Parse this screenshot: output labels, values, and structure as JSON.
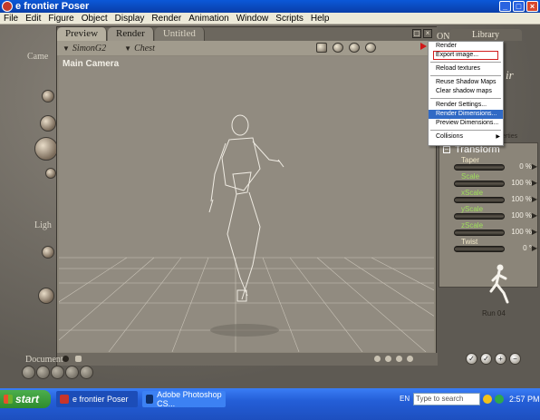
{
  "window": {
    "title": "e frontier Poser"
  },
  "menubar": [
    "File",
    "Edit",
    "Figure",
    "Object",
    "Display",
    "Render",
    "Animation",
    "Window",
    "Scripts",
    "Help"
  ],
  "left_palette": {
    "camera_label": "Came",
    "light_label": "Ligh",
    "document_label": "Document"
  },
  "document": {
    "tabs": [
      "Preview",
      "Render",
      "Untitled"
    ],
    "figure_selector": "SimonG2",
    "actor_selector": "Chest",
    "camera_label": "Main Camera"
  },
  "render_menu": {
    "items": [
      {
        "label": "Render"
      },
      {
        "label": "Export image...",
        "boxed": true
      },
      {
        "sep": true
      },
      {
        "label": "Reload textures"
      },
      {
        "sep": true
      },
      {
        "label": "Reuse Shadow Maps"
      },
      {
        "label": "Clear shadow maps"
      },
      {
        "sep": true
      },
      {
        "label": "Render Settings..."
      },
      {
        "label": "Render Dimensions...",
        "highlighted": true
      },
      {
        "label": "Preview Dimensions..."
      },
      {
        "sep": true
      },
      {
        "label": "Collisions",
        "submenu": true
      }
    ]
  },
  "library": {
    "tab_label": "Library",
    "side_text": "ONTE",
    "partial_label": "ir",
    "properties_label": "erties"
  },
  "parameters": {
    "group_label": "Transform",
    "rows": [
      {
        "name": "Taper",
        "value": "0 %",
        "color": "#f2e8c8"
      },
      {
        "name": "Scale",
        "value": "100 %",
        "color": "#9fe05a"
      },
      {
        "name": "xScale",
        "value": "100 %",
        "color": "#9fe05a"
      },
      {
        "name": "yScale",
        "value": "100 %",
        "color": "#9fe05a"
      },
      {
        "name": "zScale",
        "value": "100 %",
        "color": "#9fe05a"
      },
      {
        "name": "Twist",
        "value": "0 °",
        "color": "#f2e8c8"
      }
    ],
    "pose_label": "Run 04"
  },
  "taskbar": {
    "start_label": "start",
    "items": [
      {
        "label": "e frontier Poser",
        "active": true
      },
      {
        "label": "Adobe Photoshop CS...",
        "active": false
      }
    ],
    "language": "EN",
    "search_placeholder": "Type to search",
    "clock": "2:57 PM"
  }
}
